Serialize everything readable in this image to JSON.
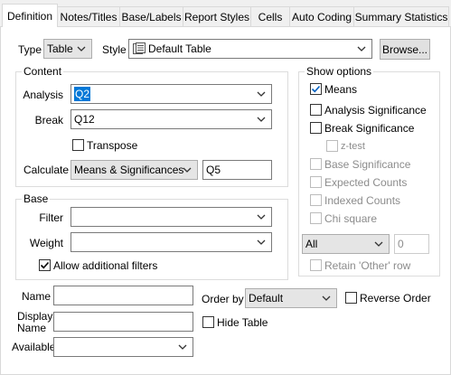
{
  "tabs": [
    {
      "label": "Definition",
      "active": true
    },
    {
      "label": "Notes/Titles"
    },
    {
      "label": "Base/Labels"
    },
    {
      "label": "Report Styles"
    },
    {
      "label": "Cells"
    },
    {
      "label": "Auto Coding"
    },
    {
      "label": "Summary Statistics"
    }
  ],
  "top": {
    "type_label": "Type",
    "type_value": "Table",
    "style_label": "Style",
    "style_value": "Default Table",
    "browse_label": "Browse..."
  },
  "content": {
    "title": "Content",
    "analysis_label": "Analysis",
    "analysis_value": "Q2",
    "break_label": "Break",
    "break_value": "Q12",
    "transpose_label": "Transpose",
    "transpose_checked": false,
    "calculate_label": "Calculate",
    "calculate_value": "Means & Significances",
    "calculate_var": "Q5"
  },
  "base": {
    "title": "Base",
    "filter_label": "Filter",
    "filter_value": "",
    "weight_label": "Weight",
    "weight_value": "",
    "allow_filters_label": "Allow additional filters",
    "allow_filters_checked": true
  },
  "show_options": {
    "title": "Show options",
    "means_label": "Means",
    "means_checked": true,
    "analysis_sig_label": "Analysis Significance",
    "break_sig_label": "Break Significance",
    "ztest_label": "z-test",
    "base_sig_label": "Base Significance",
    "expected_label": "Expected Counts",
    "indexed_label": "Indexed Counts",
    "chi_label": "Chi square",
    "all_value": "All",
    "count_value": "0",
    "retain_label": "Retain 'Other' row"
  },
  "bottom": {
    "name_label": "Name",
    "name_value": "",
    "display_name_label": "Display Name",
    "display_name_value": "",
    "available_label": "Available",
    "available_value": "",
    "order_by_label": "Order by",
    "order_by_value": "Default",
    "reverse_label": "Reverse Order",
    "hide_label": "Hide Table"
  }
}
